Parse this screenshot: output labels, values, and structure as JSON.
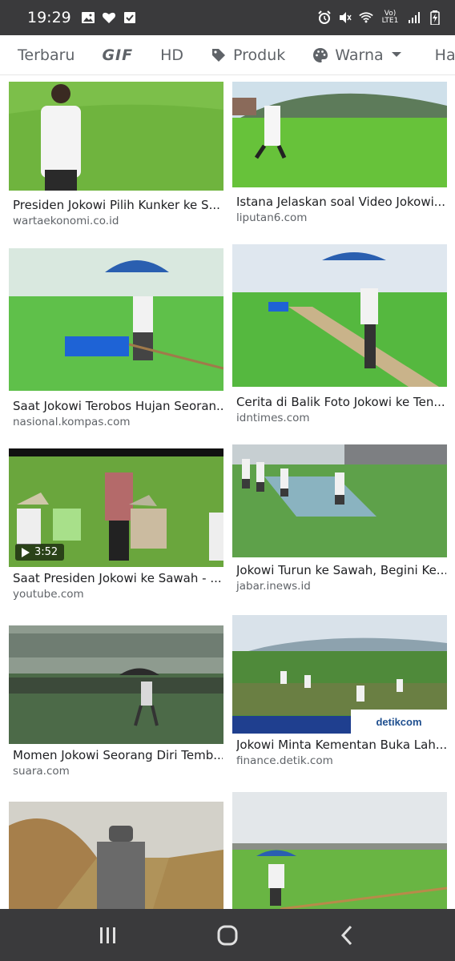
{
  "status_bar": {
    "time": "19:29",
    "network": "Vo) LTE1"
  },
  "chips": [
    {
      "label": "Terbaru"
    },
    {
      "label": "GIF"
    },
    {
      "label": "HD"
    },
    {
      "label": "Produk"
    },
    {
      "label": "Warna"
    },
    {
      "label": "Hak Peng"
    }
  ],
  "results": [
    {
      "title": "Presiden Jokowi Pilih Kunker ke S...",
      "source": "wartaekonomi.co.id"
    },
    {
      "title": "Istana Jelaskan soal Video Jokowi...",
      "source": "liputan6.com"
    },
    {
      "title": "Saat Jokowi Terobos Hujan Seoran...",
      "source": "nasional.kompas.com"
    },
    {
      "title": "Cerita di Balik Foto Jokowi ke Ten...",
      "source": "idntimes.com"
    },
    {
      "title": "Saat Presiden Jokowi ke Sawah - ...",
      "source": "youtube.com",
      "duration": "3:52"
    },
    {
      "title": "Jokowi Turun ke Sawah, Begini Ke...",
      "source": "jabar.inews.id"
    },
    {
      "title": "Momen Jokowi Seorang Diri Temb...",
      "source": "suara.com"
    },
    {
      "title": "Jokowi Minta Kementan Buka Lah...",
      "source": "finance.detik.com",
      "watermark": "detikcom"
    },
    {
      "title": "",
      "source": ""
    },
    {
      "title": "",
      "source": ""
    }
  ],
  "colors": {
    "status_bg": "#3a3a3c",
    "chip_text": "#5f6368",
    "title_text": "#202124",
    "source_text": "#5f6368"
  },
  "icons": {
    "status_left": [
      "gallery-icon",
      "heart-icon",
      "check-box-icon"
    ],
    "status_right": [
      "alarm-icon",
      "mute-icon",
      "wifi-icon",
      "signal-icon",
      "battery-icon"
    ],
    "nav": [
      "recent-apps-icon",
      "home-icon",
      "back-icon"
    ]
  }
}
